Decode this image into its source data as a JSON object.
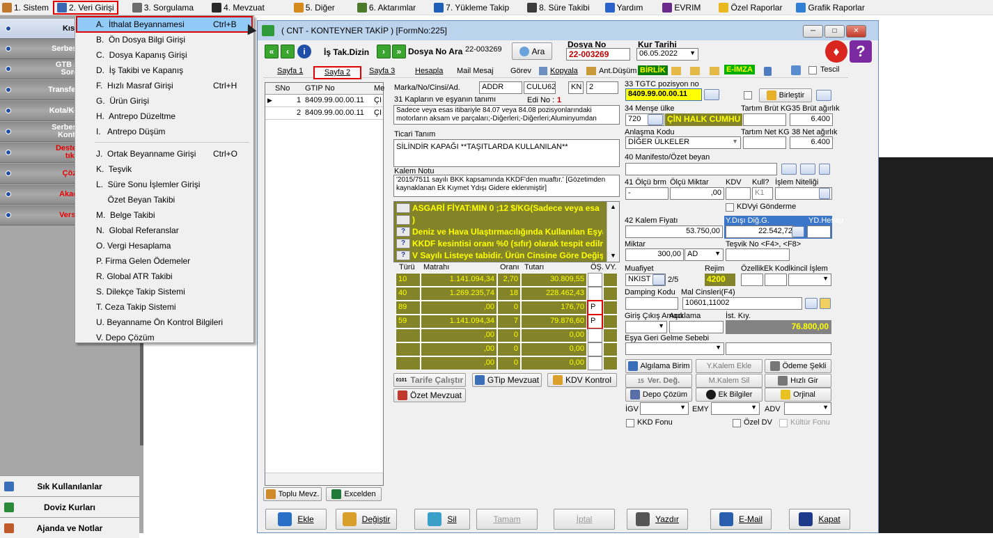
{
  "menubar": [
    {
      "label": "1.  Sistem",
      "icon": "system-icon",
      "color": "#c0782c"
    },
    {
      "label": "2.  Veri Girişi",
      "icon": "data-entry-icon",
      "color": "#3866b0",
      "active": true
    },
    {
      "label": "3.  Sorgulama",
      "icon": "query-icon",
      "color": "#6c6c6c"
    },
    {
      "label": "4.  Mevzuat",
      "icon": "law-icon",
      "color": "#2a2a2a"
    },
    {
      "label": "5.  Diğer",
      "icon": "other-icon",
      "color": "#d48a1c"
    },
    {
      "label": "6.  Aktarımlar",
      "icon": "transfer-icon",
      "color": "#4a7a2a"
    },
    {
      "label": "7.  Yükleme Takip",
      "icon": "upload-track-icon",
      "color": "#1f5fb8"
    },
    {
      "label": "8. Süre Takibi",
      "icon": "time-track-icon",
      "color": "#3c3c3c"
    },
    {
      "label": "Yardım",
      "icon": "help-icon",
      "color": "#2a63c9"
    },
    {
      "label": "EVRIM",
      "icon": "evrim-icon",
      "color": "#6a2a8c"
    },
    {
      "label": "Özel Raporlar",
      "icon": "star-icon",
      "color": "#e8b81e"
    },
    {
      "label": "Grafik Raporlar",
      "icon": "chart-icon",
      "color": "#2f7fd6"
    }
  ],
  "left": {
    "items": [
      {
        "label": "Kısayo",
        "red": false
      },
      {
        "label": "Serbest Bölg",
        "red": false
      },
      {
        "label": "GTB DIR B\nSorgula",
        "red": false
      },
      {
        "label": "Transfer Bildiri",
        "red": false
      },
      {
        "label": "Kota/Kontenja",
        "red": false
      },
      {
        "label": "Serbest Bölg\nKontrol U",
        "red": false
      },
      {
        "label": "Destek Vid\ntıklay",
        "red": true
      },
      {
        "label": "Çözüm",
        "red": true
      },
      {
        "label": "Akademi",
        "red": true
      },
      {
        "label": "Versiyon",
        "red": true
      }
    ],
    "footer": [
      "Sık Kullanılanlar",
      "Doviz Kurları",
      "Ajanda ve Notlar"
    ]
  },
  "dropdown": [
    {
      "label": "A.  İthalat Beyannamesi",
      "shortcut": "Ctrl+B",
      "highlight": true
    },
    {
      "label": "B.  Ön Dosya Bilgi Girişi",
      "shortcut": ""
    },
    {
      "label": "C.  Dosya Kapanış Girişi",
      "shortcut": ""
    },
    {
      "label": "D.  İş Takibi ve Kapanış",
      "shortcut": ""
    },
    {
      "label": "F.  Hızlı Masraf Girişi",
      "shortcut": "Ctrl+H"
    },
    {
      "label": "G.  Ürün Girişi",
      "shortcut": ""
    },
    {
      "label": "H.  Antrepo Düzeltme",
      "shortcut": ""
    },
    {
      "label": "I.   Antrepo Düşüm",
      "shortcut": ""
    },
    {
      "label": "J.  Ortak Beyanname Girişi",
      "shortcut": "Ctrl+O",
      "sepBefore": true
    },
    {
      "label": "K.  Teşvik",
      "shortcut": ""
    },
    {
      "label": "L.  Süre Sonu İşlemler Girişi",
      "shortcut": ""
    },
    {
      "label": "     Özet Beyan Takibi",
      "shortcut": ""
    },
    {
      "label": "M.  Belge Takibi",
      "shortcut": ""
    },
    {
      "label": "N.  Global Referanslar",
      "shortcut": ""
    },
    {
      "label": "O. Vergi Hesaplama",
      "shortcut": ""
    },
    {
      "label": "P. Firma Gelen Ödemeler",
      "shortcut": ""
    },
    {
      "label": "R. Global ATR Takibi",
      "shortcut": ""
    },
    {
      "label": "S. Dilekçe Takip Sistemi",
      "shortcut": ""
    },
    {
      "label": "T. Ceza Takip Sistemi",
      "shortcut": ""
    },
    {
      "label": "U. Beyanname Ön Kontrol Bilgileri",
      "shortcut": ""
    },
    {
      "label": "V. Depo Çözüm",
      "shortcut": ""
    }
  ],
  "window": {
    "title": "( CNT - KONTEYNER TAKİP ) [FormNo:225]",
    "is_tak_dizin": "İş Tak.Dizin",
    "dosya_no_ara_label": "Dosya No Ara",
    "dosya_no_ara_value": "22-003269",
    "ara_button": "Ara",
    "dosya_no_label": "Dosya No",
    "dosya_no_value": "22-003269",
    "kur_tarihi_label": "Kur Tarihi",
    "kur_tarihi_value": "06.05.2022",
    "tabs": [
      "Sayfa 1",
      "Sayfa 2",
      "Sayfa 3",
      "Hesapla",
      "Mail Mesaj",
      "Görev",
      "Kopyala",
      "Ant.Düşüm"
    ],
    "birlik": "BİRLİK",
    "eimza": "E-İMZA",
    "tescil": "Tescil",
    "grid_headers": [
      "SNo",
      "GTIP No",
      "Me"
    ],
    "grid_rows": [
      {
        "sno": "1",
        "gtip": "8409.99.00.00.11",
        "me": "ÇI"
      },
      {
        "sno": "2",
        "gtip": "8409.99.00.00.11",
        "me": "ÇI"
      }
    ],
    "toplu_mevz": "Toplu Mevz.",
    "excelden": "Excelden"
  },
  "form": {
    "marka_label": "Marka/No/Cinsi/Ad.",
    "marka_value": "ADDR",
    "marka_2": "CULU62",
    "marka_3": "KN",
    "marka_4": "2",
    "kaplar_label": "31 Kapların ve eşyanın tanımı",
    "edi_no_label": "Edi No :",
    "edi_no_value": "1",
    "tanim_text": "Sadece veya esas itibariyle 84.07 veya 84.08 pozisyonlarındaki motorların aksam ve parçaları;-Diğerleri;-Diğerleri;Aluminyumdan",
    "ticari_label": "Ticari Tanım",
    "ticari_value": "SİLİNDİR KAPAĞI **TAŞITLARDA KULLANILAN**",
    "kalem_notu_label": "Kalem Notu",
    "kalem_notu_value": "'2015/7511 sayılı BKK kapsamında KKDF'den muaftır.' [Gözetimden kaynaklanan Ek Kıymet Ydışı Gidere eklenmiştir]",
    "warnings": [
      {
        "q": "",
        "text": "ASGARİ FİYAT:MIN 0 ;12 $/KG(Sadece veya esa"
      },
      {
        "q": "",
        "text": ")"
      },
      {
        "q": "?",
        "text": "Deniz ve Hava Ulaştırmacılığında Kullanılan Eşya"
      },
      {
        "q": "?",
        "text": "KKDF kesintisi oranı %0 (sıfır) olarak tespit edilm"
      },
      {
        "q": "?",
        "text": "V Sayılı Listeye tabidir. Ürün Cinsine Göre Değiş"
      }
    ],
    "tax_headers": [
      "Türü",
      "Matrahı",
      "Oranı",
      "Tutarı",
      "ÖŞ.",
      "VY."
    ],
    "tax_rows": [
      {
        "turu": "10",
        "matrah": "1.141.094,34",
        "oran": "2,70",
        "tutar": "30.809,55",
        "os": "",
        "vy": ""
      },
      {
        "turu": "40",
        "matrah": "1.269.235,74",
        "oran": "18",
        "tutar": "228.462,43",
        "os": "",
        "vy": ""
      },
      {
        "turu": "89",
        "matrah": ",00",
        "oran": "0",
        "tutar": "176,70",
        "os": "P",
        "vy": ""
      },
      {
        "turu": "59",
        "matrah": "1.141.094,34",
        "oran": "7",
        "tutar": "79.876,60",
        "os": "P",
        "vy": ""
      },
      {
        "turu": "",
        "matrah": ",00",
        "oran": "0",
        "tutar": "0,00",
        "os": "",
        "vy": ""
      },
      {
        "turu": "",
        "matrah": ",00",
        "oran": "0",
        "tutar": "0,00",
        "os": "",
        "vy": ""
      },
      {
        "turu": "",
        "matrah": ",00",
        "oran": "0",
        "tutar": "0,00",
        "os": "",
        "vy": ""
      }
    ],
    "tarife_btn": "Tarife Çalıştır",
    "gtip_btn": "GTip Mevzuat",
    "kdv_btn": "KDV Kontrol",
    "ozet_btn": "Özet Mevzuat",
    "tgtc_label": "33 TGTC pozisyon no",
    "tgtc_value": "8409.99.00.00.11",
    "birlestir": "Birleştir",
    "mense_label": "34 Menşe ülke",
    "mense_code": "720",
    "mense_name": "ÇİN HALK CUMHU",
    "tartim_brut_label": "Tartım Brüt KG",
    "brut_label": "35 Brüt ağırlık",
    "brut_value": "6.400",
    "anlasma_label": "Anlaşma Kodu",
    "anlasma_value": "DİĞER ÜLKELER",
    "tartim_net_label": "Tartım Net KG",
    "net_label": "38 Net ağırlık",
    "net_value": "6.400",
    "manifesto_label": "40 Manifesto/Özet beyan",
    "olcu_brm_label": "41 Ölçü brm",
    "olcu_miktar_label": "Ölçü Miktar",
    "kdv_label": "KDV",
    "kull_label": "Kull?",
    "islem_niteligi_label": "İşlem Niteliği",
    "olcu_brm_value": "-",
    "olcu_miktar_value": ",00",
    "kull_value": "K1",
    "kdv_gonderme": "KDVyi Gönderme",
    "kalem_fiyati_label": "42 Kalem Fiyatı",
    "kalem_fiyati_value": "53.750,00",
    "ydisi_label": "Y.Dışı Diğ.G.",
    "ydisi_value": "22.542,72",
    "yd_hesap_label": "YD.Hesap",
    "miktar_label": "Miktar",
    "miktar_value": "300,00",
    "miktar_unit": "AD",
    "tesvik_label": "Teşvik No <F4>, <F8>",
    "muafiyet_label": "Muafiyet",
    "muafiyet_value": "NKIST",
    "muafiyet_page": "2/5",
    "rejim_label": "Rejim",
    "rejim_value": "4200",
    "ozellik_label": "Özellik",
    "ek_kod_label": "Ek Kod",
    "ikincil_label": "İkincil İşlem",
    "damping_label": "Damping Kodu",
    "mal_cinsleri_label": "Mal Cinsleri(F4)",
    "mal_cinsleri_value": "10601,11002",
    "giris_cikis_label": "Giriş Çıkış Amacı",
    "aciklama_label": "Açıklama",
    "ist_kiy_label": "İst. Kıy.",
    "ist_kiy_value": "76.800,00",
    "esya_geri_label": "Eşya Geri Gelme Sebebi",
    "algilama_btn": "Algılama Birim",
    "ykalem_btn": "Y.Kalem Ekle",
    "odeme_btn": "Ödeme Şekli",
    "ver_deg_btn": "Ver. Değ.",
    "mkalem_btn": "M.Kalem Sil",
    "hizli_btn": "Hızlı Gir",
    "depo_btn": "Depo Çözüm",
    "ek_bilgiler_btn": "Ek Bilgiler",
    "orijinal_btn": "Orjinal",
    "igv_label": "İGV",
    "emy_label": "EMY",
    "adv_label": "ADV",
    "kkd_fonu": "KKD Fonu",
    "ozel_dv": "Özel DV",
    "kultur_fonu": "Kültür Fonu"
  },
  "bottom_buttons": [
    {
      "label": "Ekle",
      "icon": "add-document-icon",
      "disabled": false
    },
    {
      "label": "Değiştir",
      "icon": "edit-icon",
      "disabled": false
    },
    {
      "label": "Sil",
      "icon": "delete-icon",
      "disabled": false
    },
    {
      "label": "Tamam",
      "icon": "",
      "disabled": true
    },
    {
      "label": "İptal",
      "icon": "",
      "disabled": true
    },
    {
      "label": "Yazdır",
      "icon": "printer-icon",
      "disabled": false
    },
    {
      "label": "E-Mail",
      "icon": "email-icon",
      "disabled": false
    },
    {
      "label": "Kapat",
      "icon": "exit-icon",
      "disabled": false
    }
  ]
}
